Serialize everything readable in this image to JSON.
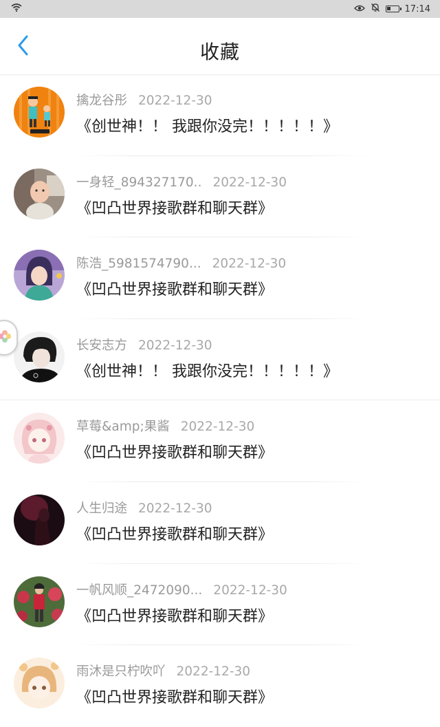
{
  "status_bar": {
    "time": "17:14"
  },
  "header": {
    "title": "收藏"
  },
  "items": [
    {
      "name": "擒龙谷彤",
      "date": "2022-12-30",
      "message": "《创世神！！ 我跟你没完！！！！！》"
    },
    {
      "name": "一身轻_894327170..",
      "date": "2022-12-30",
      "message": "《凹凸世界接歌群和聊天群》"
    },
    {
      "name": "陈浩_5981574790...",
      "date": "2022-12-30",
      "message": "《凹凸世界接歌群和聊天群》"
    },
    {
      "name": "长安志方",
      "date": "2022-12-30",
      "message": "《创世神！！ 我跟你没完！！！！！》"
    },
    {
      "name": "草莓&amp;果酱",
      "date": "2022-12-30",
      "message": "《凹凸世界接歌群和聊天群》"
    },
    {
      "name": "人生归途",
      "date": "2022-12-30",
      "message": "《凹凸世界接歌群和聊天群》"
    },
    {
      "name": "一帆风顺_2472090...",
      "date": "2022-12-30",
      "message": "《凹凸世界接歌群和聊天群》"
    },
    {
      "name": "雨沐是只柠吹吖",
      "date": "2022-12-30",
      "message": "《凹凸世界接歌群和聊天群》"
    }
  ],
  "colors": {
    "accent": "#2b9be8",
    "name_text": "#9a9a9a",
    "message_text": "#222222"
  }
}
